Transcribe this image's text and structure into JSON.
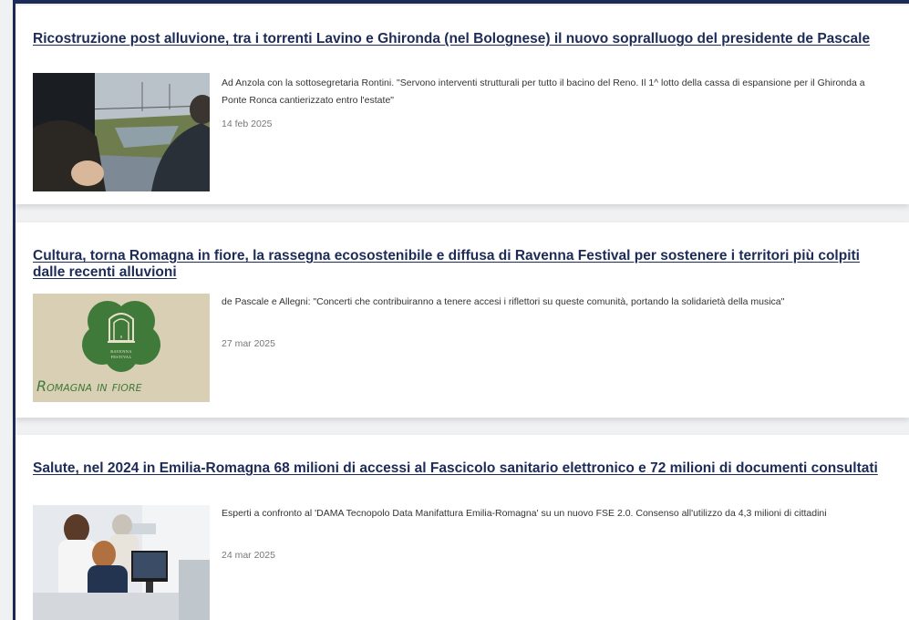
{
  "articles": [
    {
      "title": "Ricostruzione post alluvione, tra i torrenti Lavino e Ghironda (nel Bolognese) il nuovo sopralluogo del presidente de Pascale",
      "description": "Ad Anzola con la sottosegretaria Rontini. \"Servono interventi strutturali per tutto il bacino del Reno. Il 1^ lotto della cassa di espansione per il Ghironda a Ponte Ronca cantierizzato entro l'estate\"",
      "date": "14 feb 2025",
      "image": "photo-officials-at-river-site"
    },
    {
      "title": "Cultura, torna Romagna in fiore, la rassegna ecosostenibile e diffusa di Ravenna Festival per sostenere i territori più colpiti dalle recenti alluvioni",
      "description": "de Pascale e Allegni: \"Concerti che contribuiranno a tenere accesi i riflettori su queste comunità, portando la solidarietà della musica\"",
      "date": "27 mar 2025",
      "image": "romagna-in-fiore-logo",
      "logo_badge_line1": "RAVENNA",
      "logo_badge_line2": "FESTIVAL",
      "logo_text": "Romagna in fiore"
    },
    {
      "title": "Salute, nel 2024 in Emilia-Romagna 68 milioni di accessi al Fascicolo sanitario elettronico e 72 milioni di documenti consultati",
      "description": "Esperti a confronto al 'DAMA Tecnopolo Data Manifattura Emilia-Romagna' su un nuovo FSE 2.0. Consenso all'utilizzo da 4,3 milioni di cittadini",
      "date": "24 mar 2025",
      "image": "photo-people-at-computer"
    }
  ],
  "colors": {
    "title": "#1d2b57",
    "frame": "#1d2b57",
    "logo_green": "#3f7a3a",
    "logo_bg": "#d9cfb4"
  }
}
